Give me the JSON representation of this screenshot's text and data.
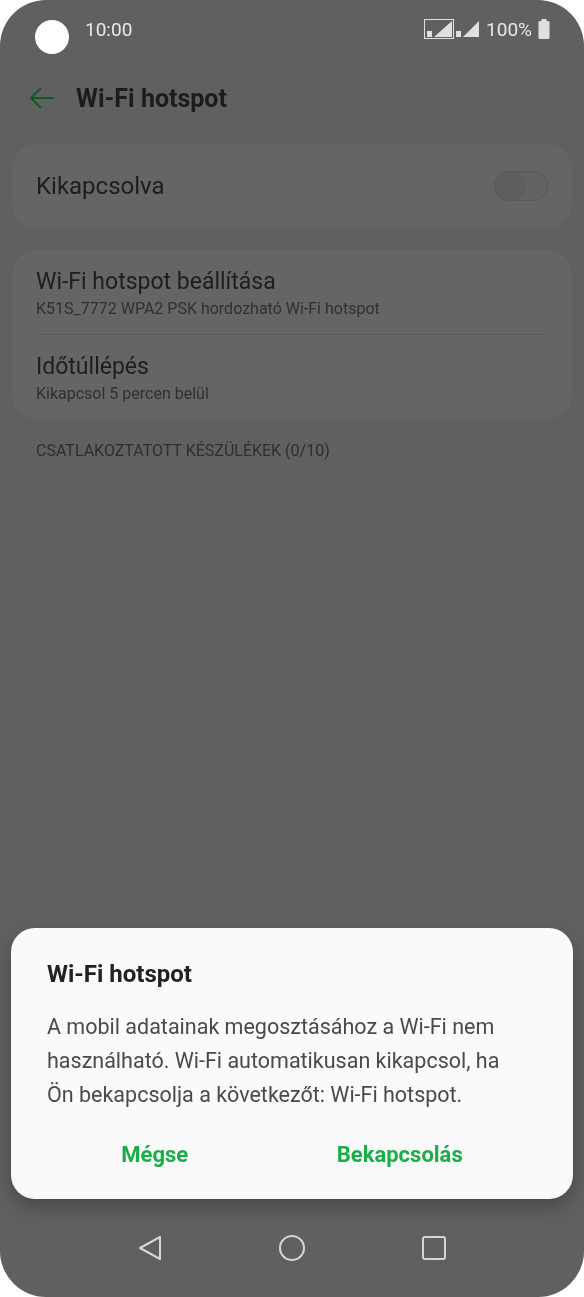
{
  "status_bar": {
    "time": "10:00",
    "battery": "100%"
  },
  "header": {
    "title": "Wi-Fi hotspot"
  },
  "master_switch": {
    "label": "Kikapcsolva",
    "on": false
  },
  "settings": [
    {
      "title": "Wi-Fi hotspot beállítása",
      "subtitle": "K51S_7772 WPA2 PSK hordozható Wi-Fi hotspot"
    },
    {
      "title": "Időtúllépés",
      "subtitle": "Kikapcsol 5 percen belül"
    }
  ],
  "section_label": "CSATLAKOZTATOTT KÉSZÜLÉKEK (0/10)",
  "dialog": {
    "title": "Wi-Fi hotspot",
    "message": "A mobil adatainak megosztásához a Wi-Fi nem használható. Wi-Fi automatikusan kikapcsol, ha Ön bekapcsolja a következőt: Wi-Fi hotspot.",
    "buttons": [
      "Mégse",
      "Bekapcsolás"
    ]
  }
}
